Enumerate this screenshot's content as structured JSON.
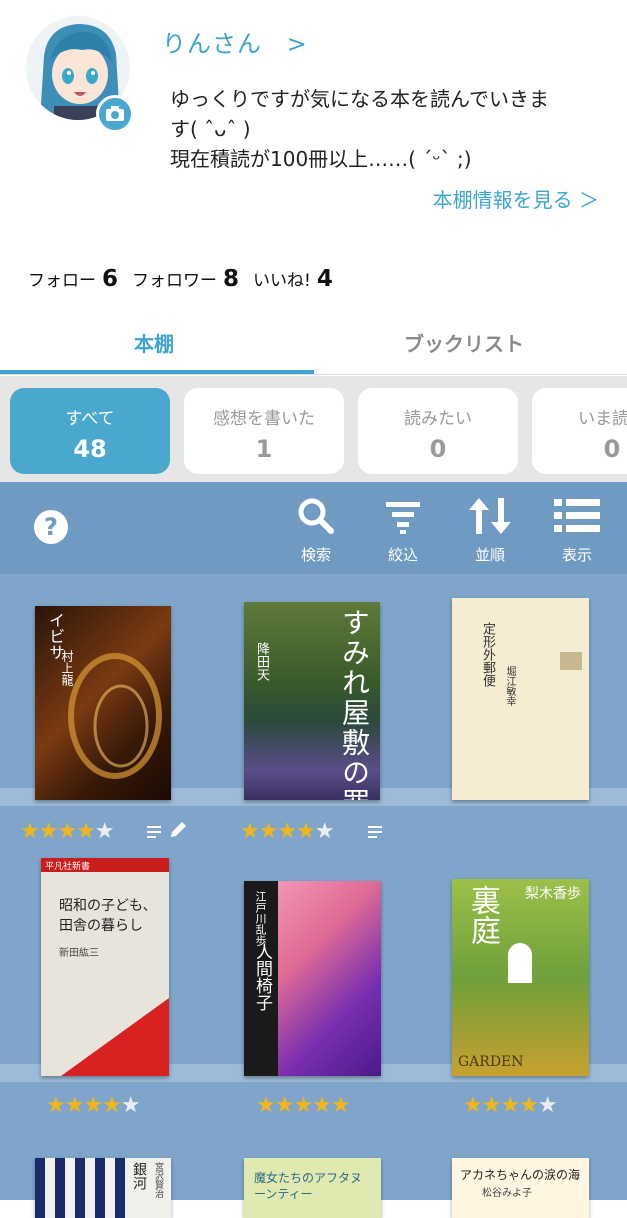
{
  "profile": {
    "username": "りんさん",
    "username_arrow": ">",
    "bio_lines": [
      "ゆっくりですが気になる本を読んでいきま",
      "す( ˆᴗˆ )",
      "現在積読が100冊以上……( ´ᵕ` ;)"
    ],
    "shelf_info_link": "本棚情報を見る ＞"
  },
  "stats": {
    "follow_label": "フォロー",
    "follow_count": "6",
    "follower_label": "フォロワー",
    "follower_count": "8",
    "like_label": "いいね!",
    "like_count": "4"
  },
  "tabs": [
    {
      "label": "本棚",
      "active": true
    },
    {
      "label": "ブックリスト",
      "active": false
    }
  ],
  "filters": [
    {
      "label": "すべて",
      "count": "48",
      "active": true
    },
    {
      "label": "感想を書いた",
      "count": "1",
      "active": false
    },
    {
      "label": "読みたい",
      "count": "0",
      "active": false
    },
    {
      "label": "いま読ん",
      "count": "0",
      "active": false
    }
  ],
  "toolbar": {
    "search": "検索",
    "filter": "絞込",
    "sort": "並順",
    "view": "表示"
  },
  "icons": {
    "help": "help-icon",
    "camera": "camera-icon",
    "search": "search-icon",
    "filter": "filter-icon",
    "sort": "sort-icon",
    "view": "list-view-icon",
    "memo": "memo-icon",
    "pencil": "pencil-icon"
  },
  "colors": {
    "accent": "#3fa5cf",
    "toolbar": "#6f9ac1",
    "shelf": "#7fa6ca",
    "star": "#f2b51a"
  },
  "books": [
    {
      "title": "イビサ",
      "author": "村上龍",
      "rating": 4,
      "has_memo": true,
      "has_review": true
    },
    {
      "title": "すみれ屋敷の罪人",
      "author": "降田天",
      "rating": 4,
      "has_memo": true,
      "has_review": false
    },
    {
      "title": "定形外郵便",
      "author": "堀江敏幸",
      "rating": 0,
      "has_memo": false,
      "has_review": false
    },
    {
      "title": "昭和の子ども、田舎の暮らし",
      "author": "新田紘三",
      "publisher": "平凡社新書",
      "rating": 4,
      "has_memo": false,
      "has_review": false
    },
    {
      "title": "人間椅子",
      "author": "江戸川乱歩",
      "rating": 5,
      "has_memo": false,
      "has_review": false
    },
    {
      "title": "裏庭",
      "author": "梨木香歩",
      "subtitle": "GARDEN",
      "rating": 4,
      "has_memo": false,
      "has_review": false
    },
    {
      "title": "銀河",
      "author": "宮沢賢治",
      "rating": 0,
      "has_memo": false,
      "has_review": false
    },
    {
      "title": "魔女たちのアフタヌーンティー",
      "author": "",
      "rating": 0,
      "has_memo": false,
      "has_review": false
    },
    {
      "title": "アカネちゃんの涙の海",
      "author": "松谷みよ子",
      "rating": 0,
      "has_memo": false,
      "has_review": false
    }
  ]
}
